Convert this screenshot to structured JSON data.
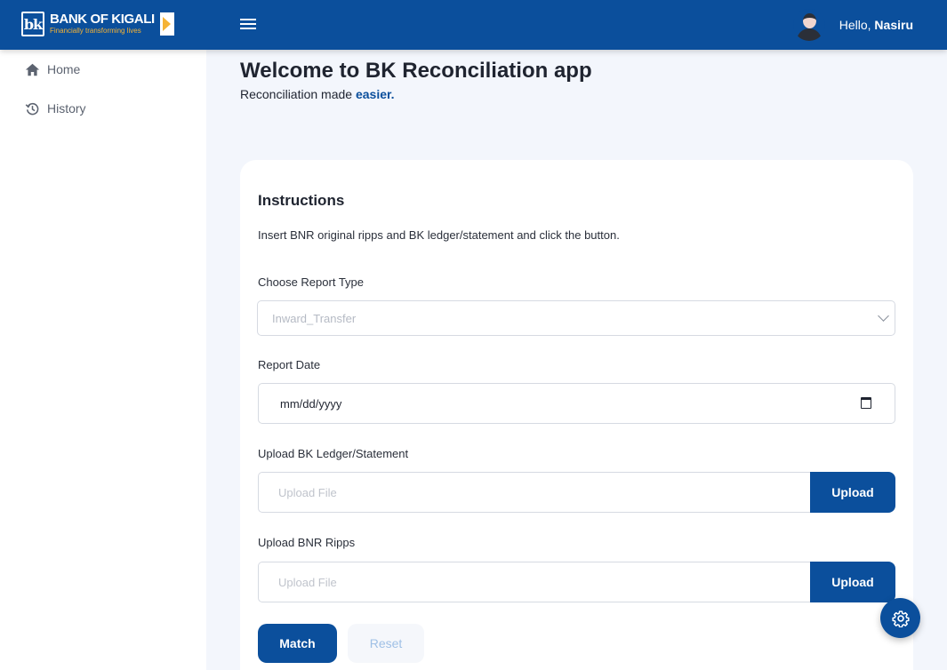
{
  "brand": {
    "name": "BANK OF KIGALI",
    "tagline": "Financially transforming lives",
    "mark": "bk",
    "primary_color": "#0b4f9c",
    "accent_color": "#f5b335"
  },
  "header": {
    "menu_icon": "hamburger-icon",
    "greeting": "Hello,",
    "user_name": "Nasiru"
  },
  "sidebar": {
    "items": [
      {
        "label": "Home",
        "icon": "home-icon"
      },
      {
        "label": "History",
        "icon": "history-icon"
      }
    ]
  },
  "main": {
    "title": "Welcome to BK Reconciliation app",
    "subtitle_prefix": "Reconciliation made ",
    "subtitle_accent": "easier."
  },
  "form": {
    "heading": "Instructions",
    "instructions": "Insert BNR original ripps and BK ledger/statement and click the button.",
    "report_type_label": "Choose Report Type",
    "report_type_value": "Inward_Transfer",
    "report_date_label": "Report Date",
    "report_date_placeholder": "mm/dd/yyyy",
    "ledger_label": "Upload BK Ledger/Statement",
    "ledger_placeholder": "Upload File",
    "ledger_button": "Upload",
    "ripps_label": "Upload BNR Ripps",
    "ripps_placeholder": "Upload File",
    "ripps_button": "Upload",
    "match_button": "Match",
    "reset_button": "Reset"
  },
  "fab": {
    "icon": "gear-icon"
  }
}
